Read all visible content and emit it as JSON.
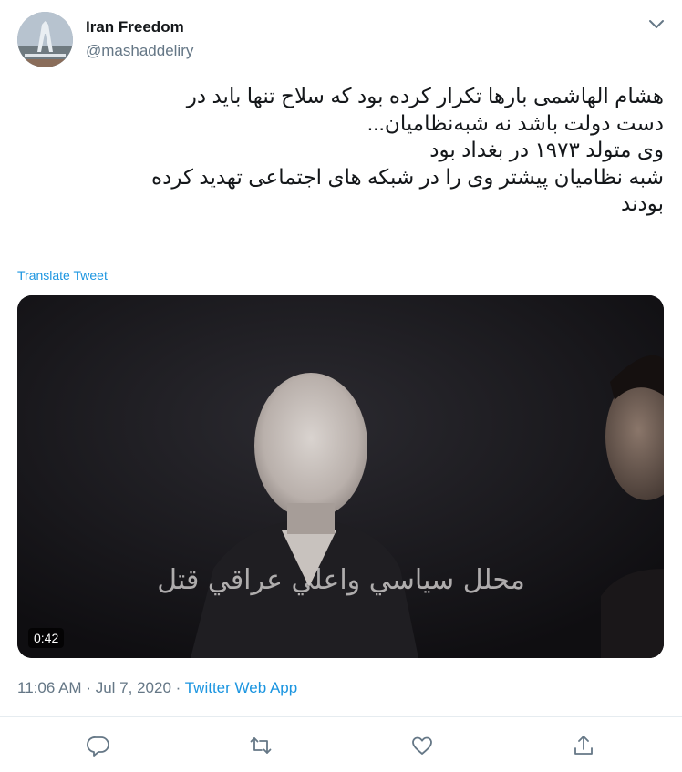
{
  "author": {
    "display_name": "Iran Freedom",
    "handle": "@mashaddeliry"
  },
  "tweet": {
    "lines": [
      "هشام الهاشمی بارها تکرار کرده بود که سلاح تنها باید در",
      "دست دولت باشد نه شبه‌نظامیان...",
      "وی متولد ۱۹۷۳ در بغداد بود",
      "شبه نظامیان پیشتر وی را در شبکه های اجتماعی تهدید کرده",
      "بودند"
    ],
    "translate_label": "Translate Tweet"
  },
  "video": {
    "caption_overlay": "محلل سياسي واعلي عراقي قتل",
    "duration": "0:42"
  },
  "meta": {
    "time": "11:06 AM",
    "separator": "·",
    "date": "Jul 7, 2020",
    "source": "Twitter Web App"
  },
  "actions": [
    "reply-icon",
    "retweet-icon",
    "like-icon",
    "share-icon"
  ],
  "colors": {
    "link": "#1b95e0",
    "secondary_text": "#657786",
    "icon": "#657786"
  }
}
